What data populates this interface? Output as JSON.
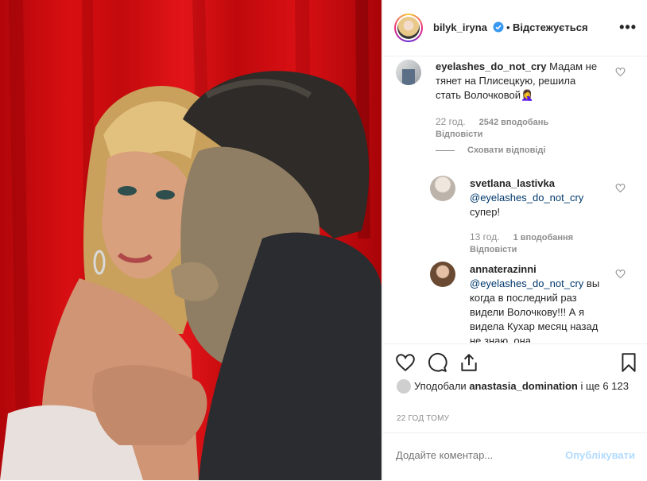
{
  "header": {
    "username": "bilyk_iryna",
    "separator": "•",
    "follow_status": "Відстежується",
    "more": "•••"
  },
  "comments": [
    {
      "username": "eyelashes_do_not_cry",
      "text": "Мадам не тянет на Плисецкую, решила стать Волочковой",
      "emoji": "🤦‍♀️",
      "time": "22 год.",
      "likes": "2542 вподобань",
      "reply": "Відповісти"
    }
  ],
  "hide_replies": "Сховати відповіді",
  "replies": [
    {
      "username": "svetlana_lastivka",
      "mention": "@eyelashes_do_not_cry",
      "text": "супер!",
      "time": "13 год.",
      "likes": "1 вподобання",
      "reply": "Відповісти"
    },
    {
      "username": "annaterazinni",
      "mention": "@eyelashes_do_not_cry",
      "text": "вы когда в последний раз видели Волочкову!!! А я видела Кухар месяц назад не знаю, она"
    }
  ],
  "likes": {
    "prefix": "Уподобали",
    "user": "anastasia_domination",
    "suffix": "і ще 6 123"
  },
  "time_ago": "22 ГОД ТОМУ",
  "comment_box": {
    "placeholder": "Додайте коментар...",
    "post": "Опублікувати"
  },
  "icons": {
    "verified": "verified-badge-icon",
    "like": "heart-icon",
    "comment": "comment-bubble-icon",
    "share": "share-icon",
    "save": "bookmark-icon"
  },
  "colors": {
    "accent": "#3897f0",
    "post_disabled": "#b3dbff",
    "mention": "#00376b",
    "muted": "#8e8e8e"
  }
}
